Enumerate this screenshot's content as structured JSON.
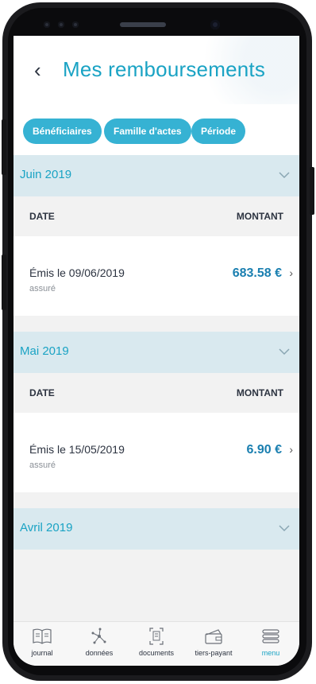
{
  "header": {
    "back_icon": "chevron-left-icon",
    "back_glyph": "‹",
    "title": "Mes remboursements"
  },
  "filters": [
    {
      "label": "Bénéficiaires"
    },
    {
      "label": "Famille d'actes"
    },
    {
      "label": "Période"
    }
  ],
  "sections": [
    {
      "month": "Juin 2019",
      "col_date": "DATE",
      "col_amount": "MONTANT",
      "rows": [
        {
          "emis": "Émis le 09/06/2019",
          "who": "assuré",
          "amount": "683.58  €",
          "go": "›"
        }
      ]
    },
    {
      "month": "Mai 2019",
      "col_date": "DATE",
      "col_amount": "MONTANT",
      "rows": [
        {
          "emis": "Émis le 15/05/2019",
          "who": "assuré",
          "amount": "6.90  €",
          "go": "›"
        }
      ]
    },
    {
      "month": "Avril 2019"
    }
  ],
  "nav": [
    {
      "label": "journal",
      "icon": "book-icon"
    },
    {
      "label": "données",
      "icon": "network-icon"
    },
    {
      "label": "documents",
      "icon": "document-scan-icon"
    },
    {
      "label": "tiers-payant",
      "icon": "card-wallet-icon"
    },
    {
      "label": "menu",
      "icon": "menu-icon",
      "active": true
    }
  ],
  "colors": {
    "accent": "#1aa3c4",
    "chip": "#36b2d3",
    "section_bg": "#d9e9ef",
    "amount": "#1a7fb0"
  }
}
